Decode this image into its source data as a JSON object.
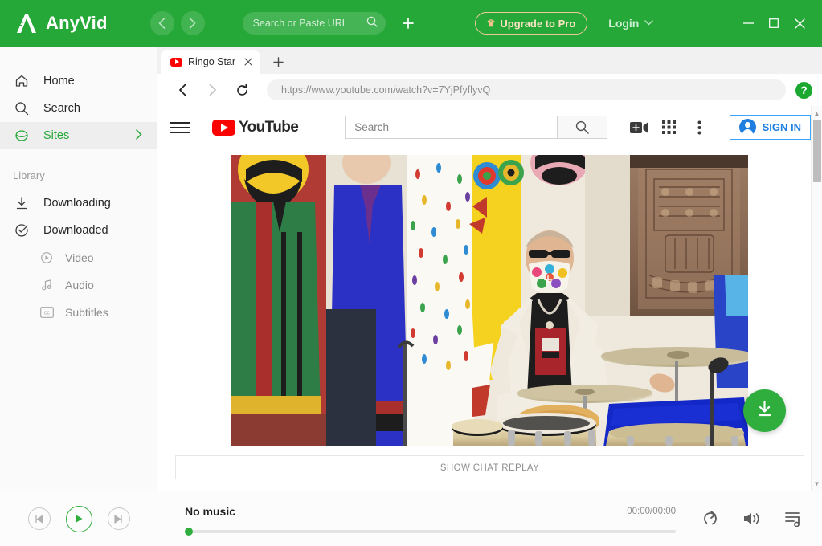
{
  "app": {
    "name": "AnyVid",
    "logo_icon": "anyvid-logo-icon"
  },
  "topbar": {
    "back_icon": "chevron-left-icon",
    "forward_icon": "chevron-right-icon",
    "search": {
      "placeholder": "Search or Paste URL",
      "icon": "search-icon"
    },
    "add_icon": "plus-icon",
    "upgrade_label": "Upgrade to Pro",
    "upgrade_icon": "crown-icon",
    "upgrade_border_color": "#f0c99a",
    "login_label": "Login",
    "login_chevron": "chevron-down-icon",
    "minimize_icon": "minimize-icon",
    "maximize_icon": "maximize-icon",
    "close_icon": "close-icon",
    "background_color": "#26a838"
  },
  "sidebar": {
    "items": [
      {
        "label": "Home",
        "icon": "home-icon"
      },
      {
        "label": "Search",
        "icon": "search-icon"
      },
      {
        "label": "Sites",
        "icon": "globe-icon",
        "active": true,
        "arrow": "chevron-right-icon"
      }
    ],
    "library_title": "Library",
    "library_items": [
      {
        "label": "Downloading",
        "icon": "download-arrow-icon"
      },
      {
        "label": "Downloaded",
        "icon": "check-circle-icon"
      }
    ],
    "sub_items": [
      {
        "label": "Video",
        "icon": "play-circle-icon"
      },
      {
        "label": "Audio",
        "icon": "music-note-icon"
      },
      {
        "label": "Subtitles",
        "icon": "closed-caption-icon"
      }
    ],
    "active_color": "#26a838"
  },
  "browser": {
    "tab": {
      "title": "Ringo Star",
      "favicon": "youtube-favicon",
      "close_icon": "close-icon"
    },
    "new_tab_icon": "plus-icon",
    "back_icon": "chevron-left-icon",
    "forward_icon": "chevron-right-icon",
    "reload_icon": "reload-icon",
    "url": "https://www.youtube.com/watch?v=7YjPfyflyvQ",
    "help_label": "?",
    "help_icon": "help-circle-icon"
  },
  "youtube": {
    "menu_icon": "hamburger-menu-icon",
    "logo_text": "YouTube",
    "logo_icon": "youtube-logo-icon",
    "search_placeholder": "Search",
    "search_button_icon": "search-icon",
    "create_icon": "video-camera-plus-icon",
    "apps_icon": "apps-grid-icon",
    "more_icon": "kebab-menu-icon",
    "signin_label": "SIGN IN",
    "signin_avatar_icon": "account-avatar-icon",
    "signin_color": "#3ea6ff",
    "chat_replay_label": "SHOW CHAT REPLAY",
    "scrollbar_up_icon": "triangle-up-icon",
    "scrollbar_down_icon": "triangle-down-icon"
  },
  "video": {
    "description": "Ringo Starr seated at a drum kit in front of colorful pop-art cutout figures and a patterned tapestry",
    "alt_title": "Ringo Star"
  },
  "download_fab": {
    "icon": "download-icon",
    "color": "#2fae3e"
  },
  "player": {
    "prev_icon": "skip-previous-icon",
    "play_icon": "play-icon",
    "next_icon": "skip-next-icon",
    "title": "No music",
    "time": "00:00/00:00",
    "repeat_icon": "repeat-icon",
    "volume_icon": "volume-icon",
    "playlist_icon": "playlist-icon",
    "accent_color": "#2fae3e",
    "progress_percent": 0
  }
}
